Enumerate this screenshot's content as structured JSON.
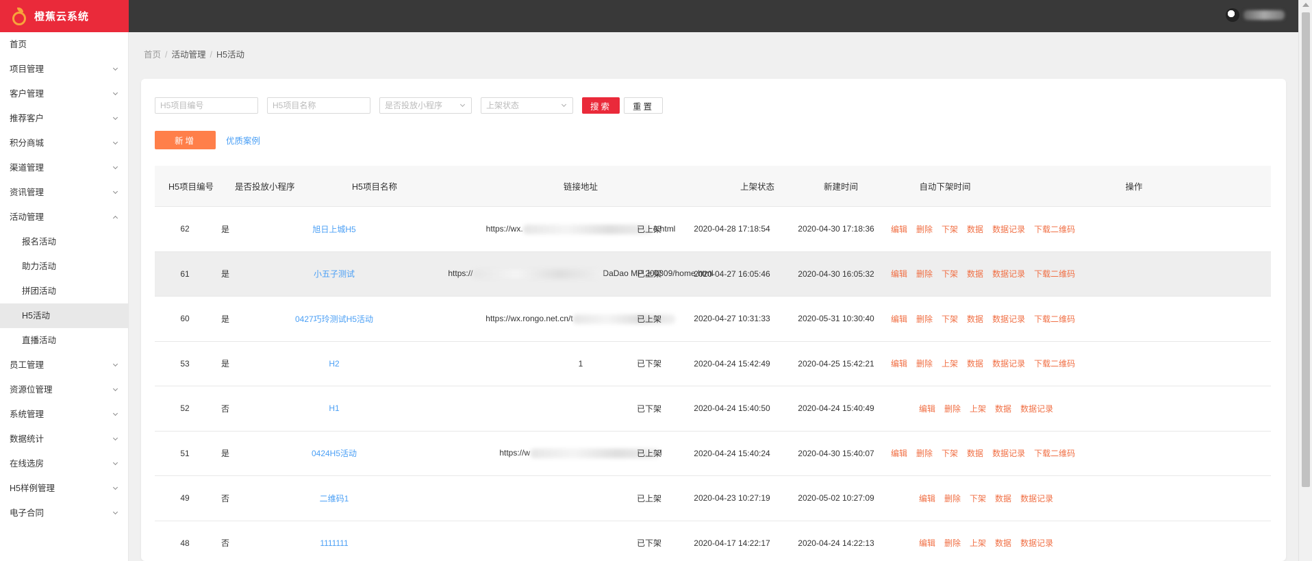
{
  "app": {
    "title": "橙蕉云系统"
  },
  "sidebar": {
    "items": [
      {
        "label": "首页",
        "chevron": false
      },
      {
        "label": "项目管理",
        "chevron": true
      },
      {
        "label": "客户管理",
        "chevron": true
      },
      {
        "label": "推荐客户",
        "chevron": true
      },
      {
        "label": "积分商城",
        "chevron": true
      },
      {
        "label": "渠道管理",
        "chevron": true
      },
      {
        "label": "资讯管理",
        "chevron": true
      },
      {
        "label": "活动管理",
        "chevron": true,
        "expanded": true
      },
      {
        "label": "报名活动",
        "sub": true
      },
      {
        "label": "助力活动",
        "sub": true
      },
      {
        "label": "拼团活动",
        "sub": true
      },
      {
        "label": "H5活动",
        "sub": true,
        "active": true
      },
      {
        "label": "直播活动",
        "sub": true
      },
      {
        "label": "员工管理",
        "chevron": true
      },
      {
        "label": "资源位管理",
        "chevron": true
      },
      {
        "label": "系统管理",
        "chevron": true
      },
      {
        "label": "数据统计",
        "chevron": true
      },
      {
        "label": "在线选房",
        "chevron": true
      },
      {
        "label": "H5样例管理",
        "chevron": true
      },
      {
        "label": "电子合同",
        "chevron": true
      }
    ]
  },
  "breadcrumb": {
    "home": "首页",
    "section": "活动管理",
    "current": "H5活动"
  },
  "filters": {
    "code_placeholder": "H5项目编号",
    "name_placeholder": "H5项目名称",
    "miniprogram_placeholder": "是否投放小程序",
    "status_placeholder": "上架状态",
    "search_label": "搜索",
    "reset_label": "重置"
  },
  "actions": {
    "add_label": "新增",
    "cases_label": "优质案例"
  },
  "table": {
    "headers": {
      "code": "H5项目编号",
      "miniprogram": "是否投放小程序",
      "name": "H5项目名称",
      "url": "链接地址",
      "status": "上架状态",
      "created": "新建时间",
      "auto_off": "自动下架时间",
      "ops": "操作"
    },
    "rows": [
      {
        "code": "62",
        "miniprogram": "是",
        "name": "旭日上城H5",
        "url_prefix": "https://wx.",
        "url_suffix": "e.html",
        "status": "已上架",
        "created": "2020-04-28 17:18:54",
        "auto_off": "2020-04-30 17:18:36",
        "ops": [
          "编辑",
          "删除",
          "下架",
          "数据",
          "数据记录",
          "下载二维码"
        ]
      },
      {
        "code": "61",
        "miniprogram": "是",
        "name": "小五子测试",
        "url_prefix": "https://",
        "url_suffix": "DaDao MP 200309/home.html",
        "status": "已上架",
        "created": "2020-04-27 16:05:46",
        "auto_off": "2020-04-30 16:05:32",
        "ops": [
          "编辑",
          "删除",
          "下架",
          "数据",
          "数据记录",
          "下载二维码"
        ]
      },
      {
        "code": "60",
        "miniprogram": "是",
        "name": "0427巧玲测试H5活动",
        "url_prefix": "https://wx.rongo.net.cn/t",
        "url_suffix": "",
        "status": "已上架",
        "created": "2020-04-27 10:31:33",
        "auto_off": "2020-05-31 10:30:40",
        "ops": [
          "编辑",
          "删除",
          "下架",
          "数据",
          "数据记录",
          "下载二维码"
        ]
      },
      {
        "code": "53",
        "miniprogram": "是",
        "name": "H2",
        "url_prefix": "1",
        "url_suffix": "",
        "status": "已下架",
        "created": "2020-04-24 15:42:49",
        "auto_off": "2020-04-25 15:42:21",
        "ops": [
          "编辑",
          "删除",
          "上架",
          "数据",
          "数据记录",
          "下载二维码"
        ]
      },
      {
        "code": "52",
        "miniprogram": "否",
        "name": "H1",
        "url_prefix": "",
        "url_suffix": "",
        "status": "已下架",
        "created": "2020-04-24 15:40:50",
        "auto_off": "2020-04-24 15:40:49",
        "ops": [
          "编辑",
          "删除",
          "上架",
          "数据",
          "数据记录"
        ]
      },
      {
        "code": "51",
        "miniprogram": "是",
        "name": "0424H5活动",
        "url_prefix": "https://w",
        "url_suffix": "l",
        "status": "已上架",
        "created": "2020-04-24 15:40:24",
        "auto_off": "2020-04-30 15:40:07",
        "ops": [
          "编辑",
          "删除",
          "下架",
          "数据",
          "数据记录",
          "下载二维码"
        ]
      },
      {
        "code": "49",
        "miniprogram": "否",
        "name": "二维码1",
        "url_prefix": "",
        "url_suffix": "",
        "status": "已上架",
        "created": "2020-04-23 10:27:19",
        "auto_off": "2020-05-02 10:27:09",
        "ops": [
          "编辑",
          "删除",
          "下架",
          "数据",
          "数据记录"
        ]
      },
      {
        "code": "48",
        "miniprogram": "否",
        "name": "1111111",
        "url_prefix": "",
        "url_suffix": "",
        "status": "已下架",
        "created": "2020-04-17 14:22:17",
        "auto_off": "2020-04-24 14:22:13",
        "ops": [
          "编辑",
          "删除",
          "上架",
          "数据",
          "数据记录"
        ]
      }
    ]
  },
  "colors": {
    "brand": "#ea2a3a",
    "topbar": "#393939",
    "accent_orange": "#ff7f4a",
    "link_blue": "#4a9ff5",
    "op_orange": "#f06f44"
  }
}
